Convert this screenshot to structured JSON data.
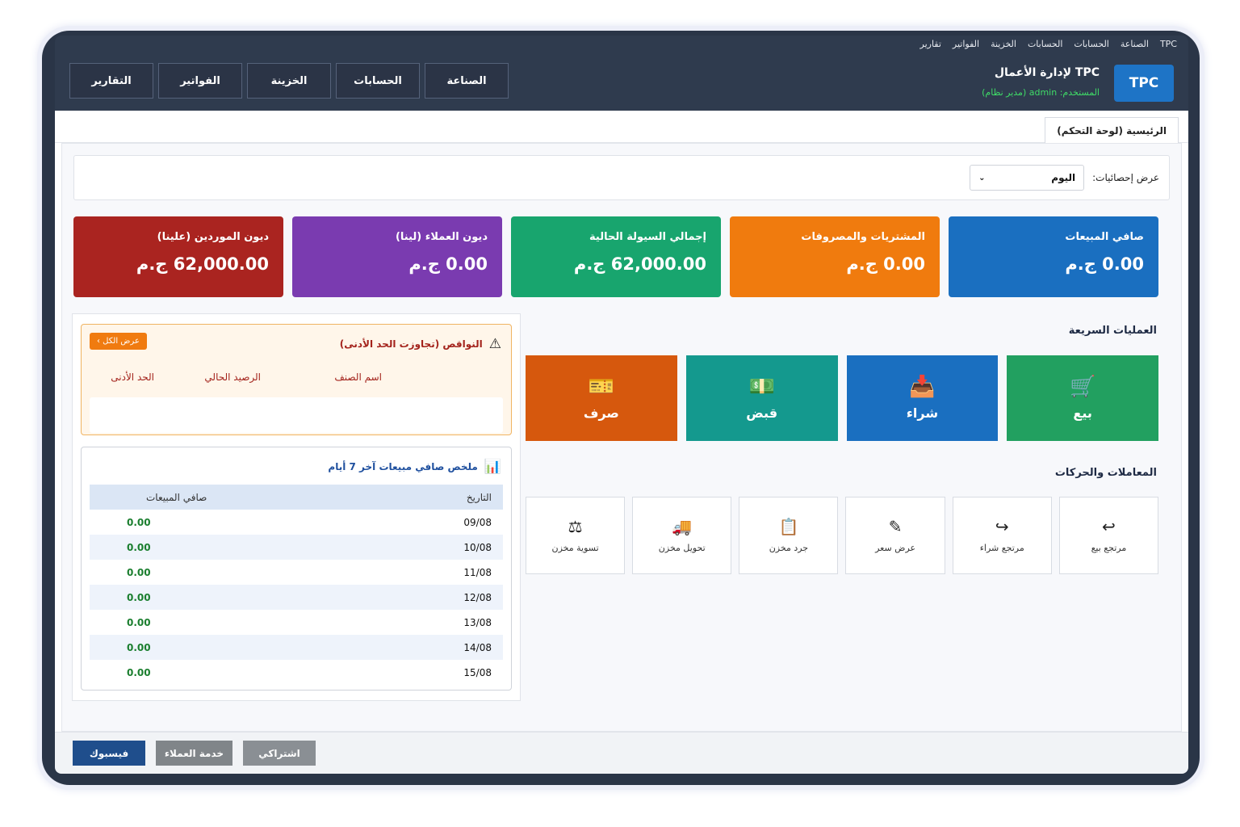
{
  "menubar": [
    "TPC",
    "الصناعة",
    "الحسابات",
    "الحسابات",
    "الخزينة",
    "الفواتير",
    "تقارير"
  ],
  "header": {
    "logo": "TPC",
    "title": "TPC لإدارة الأعمال",
    "user_line": "المستخدم: admin (مدير نظام)"
  },
  "nav": [
    "الصناعة",
    "الحسابات",
    "الخزينة",
    "الفواتير",
    "التقارير"
  ],
  "tab": "الرئيسية (لوحة التحكم)",
  "stats": {
    "label": "عرض إحصائيات:",
    "selected": "اليوم"
  },
  "cards": [
    {
      "title": "صافي المبيعات",
      "value": "0.00 ج.م",
      "color": "#1a6fc0"
    },
    {
      "title": "المشتريات والمصروفات",
      "value": "0.00 ج.م",
      "color": "#f07b0e"
    },
    {
      "title": "إجمالي السيولة الحالية",
      "value": "62,000.00 ج.م",
      "color": "#18a56e"
    },
    {
      "title": "ديون العملاء (لينا)",
      "value": "0.00 ج.م",
      "color": "#7a3bb0"
    },
    {
      "title": "ديون الموردين (علينا)",
      "value": "62,000.00 ج.م",
      "color": "#aa2420"
    }
  ],
  "quick_title": "العمليات السريعة",
  "quick": [
    {
      "label": "بيع",
      "icon": "shopping-cart-icon",
      "color": "#22a060"
    },
    {
      "label": "شراء",
      "icon": "purchase-box-icon",
      "color": "#1a6fc0"
    },
    {
      "label": "قبض",
      "icon": "cash-receipt-icon",
      "color": "#14998e"
    },
    {
      "label": "صرف",
      "icon": "payment-ticket-icon",
      "color": "#d6580d"
    }
  ],
  "trans_title": "المعاملات والحركات",
  "transactions": [
    {
      "label": "مرتجع بيع",
      "icon": "return-arrow-icon"
    },
    {
      "label": "مرتجع شراء",
      "icon": "redo-arrow-icon"
    },
    {
      "label": "عرض سعر",
      "icon": "edit-document-icon"
    },
    {
      "label": "جرد مخزن",
      "icon": "clipboard-icon"
    },
    {
      "label": "تحويل مخزن",
      "icon": "truck-icon"
    },
    {
      "label": "تسوية مخزن",
      "icon": "balance-scale-icon"
    }
  ],
  "shortage": {
    "title": "النواقص (تجاوزت الحد الأدنى)",
    "view_all": "عرض الكل ›",
    "columns": [
      "اسم الصنف",
      "الرصيد الحالي",
      "الحد الأدنى"
    ]
  },
  "sales_summary": {
    "title": "ملخص صافي مبيعات آخر 7 أيام",
    "columns": [
      "التاريخ",
      "صافي المبيعات"
    ],
    "rows": [
      {
        "date": "09/08",
        "value": "0.00"
      },
      {
        "date": "10/08",
        "value": "0.00"
      },
      {
        "date": "11/08",
        "value": "0.00"
      },
      {
        "date": "12/08",
        "value": "0.00"
      },
      {
        "date": "13/08",
        "value": "0.00"
      },
      {
        "date": "14/08",
        "value": "0.00"
      },
      {
        "date": "15/08",
        "value": "0.00"
      }
    ]
  },
  "footer": [
    {
      "label": "فيسبوك",
      "color": "#1f4e8c"
    },
    {
      "label": "خدمة العملاء",
      "color": "#808589"
    },
    {
      "label": "اشتراكي",
      "color": "#8a8f94"
    }
  ]
}
